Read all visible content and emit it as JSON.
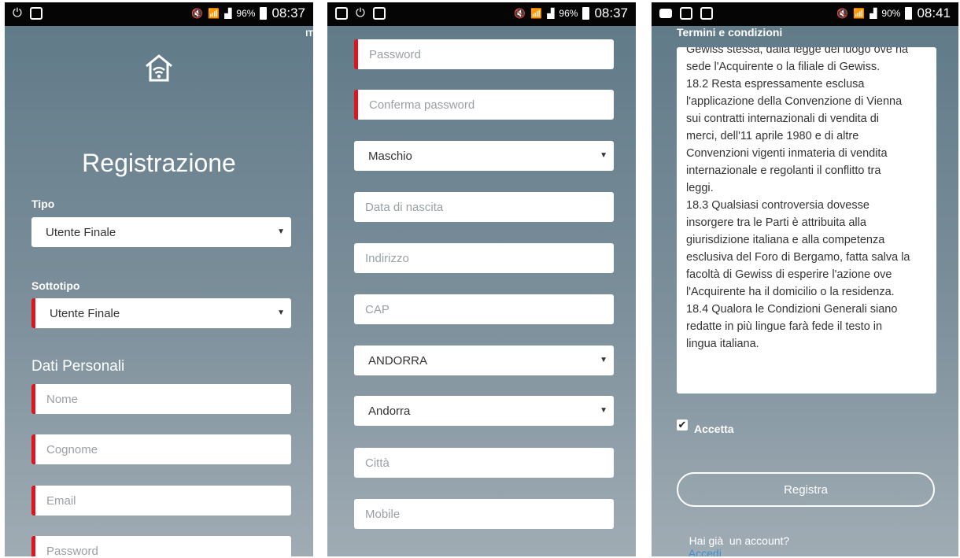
{
  "screen1": {
    "status": {
      "battery_pct": "96%",
      "time": "08:37"
    },
    "lang": "IT",
    "title": "Registrazione",
    "tipo_label": "Tipo",
    "tipo_value": "Utente Finale",
    "sottotipo_label": "Sottotipo",
    "sottotipo_value": "Utente Finale",
    "section": "Dati Personali",
    "fields": [
      "Nome",
      "Cognome",
      "Email",
      "Password"
    ]
  },
  "screen2": {
    "status": {
      "battery_pct": "96%",
      "time": "08:37"
    },
    "password": "Password",
    "confirm_password": "Conferma password",
    "gender": "Maschio",
    "birth_date": "Data di nascita",
    "address": "Indirizzo",
    "cap": "CAP",
    "country": "ANDORRA",
    "province": "Andorra",
    "city": "Città",
    "mobile": "Mobile"
  },
  "screen3": {
    "status": {
      "battery_pct": "90%",
      "time": "08:41"
    },
    "terms_title": "Termini e condizioni",
    "terms_lines": [
      "Gewiss stessa, dalla legge del luogo ove ha",
      "sede l'Acquirente o la filiale di Gewiss.",
      "18.2 Resta espressamente esclusa",
      "l'applicazione della Convenzione di Vienna",
      "sui contratti internazionali di vendita di",
      "merci, dell'11 aprile 1980 e di altre",
      "Convenzioni vigenti inmateria di vendita",
      "internazionale e regolanti il conflitto tra",
      "leggi.",
      "18.3 Qualsiasi controversia dovesse",
      "insorgere tra le Parti è attribuita alla",
      "giurisdizione italiana e alla competenza",
      "esclusiva del Foro di Bergamo, fatta salva la",
      "facoltà di Gewiss di esperire l'azione ove",
      "l'Acquirente ha il domicilio o la residenza.",
      "18.4 Qualora le Condizioni Generali siano",
      "redatte in più lingue farà fede il testo in",
      "lingua italiana."
    ],
    "accept_label": "Accetta",
    "accept_checked": true,
    "register_button": "Registra",
    "have_account": "Hai già  un account?",
    "login_link": "Accedi"
  },
  "colors": {
    "required_marker": "#e0141f",
    "link": "#3a8fd8",
    "gradient_top": "#5f7987",
    "gradient_bottom": "#a0acb4"
  },
  "icons": [
    "power-icon",
    "image-icon",
    "shield-icon",
    "mute-icon",
    "wifi-icon",
    "signal-icon",
    "battery-icon",
    "smart-home-logo-icon",
    "dropdown-caret-icon",
    "checkbox-checked-icon"
  ]
}
